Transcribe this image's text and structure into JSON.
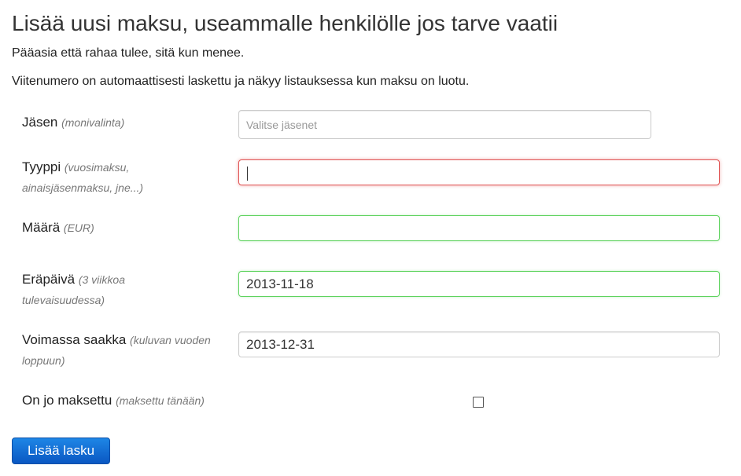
{
  "header": {
    "title": "Lisää uusi maksu, useammalle henkilölle jos tarve vaatii",
    "subtitle": "Pääasia että rahaa tulee, sitä kun menee.",
    "info": "Viitenumero on automaattisesti laskettu ja näkyy listauksessa kun maksu on luotu."
  },
  "form": {
    "member": {
      "label": "Jäsen",
      "hint": "(monivalinta)",
      "placeholder": "Valitse jäsenet"
    },
    "type": {
      "label": "Tyyppi",
      "hint_line1": "(vuosimaksu,",
      "hint_line2": "ainaisjäsenmaksu, jne...)",
      "value": ""
    },
    "amount": {
      "label": "Määrä",
      "hint": "(EUR)",
      "value": ""
    },
    "due_date": {
      "label": "Eräpäivä",
      "hint_line1": "(3 viikkoa",
      "hint_line2": "tulevaisuudessa)",
      "value": "2013-11-18"
    },
    "valid_until": {
      "label": "Voimassa saakka",
      "hint_line1": "(kuluvan vuoden",
      "hint_line2": "loppuun)",
      "value": "2013-12-31"
    },
    "paid": {
      "label": "On jo maksettu",
      "hint": "(maksettu tänään)",
      "checked": false
    },
    "submit_label": "Lisää lasku"
  },
  "colors": {
    "error_border": "#e05353",
    "valid_border": "#5fd35f",
    "button": "#0a64d0"
  }
}
